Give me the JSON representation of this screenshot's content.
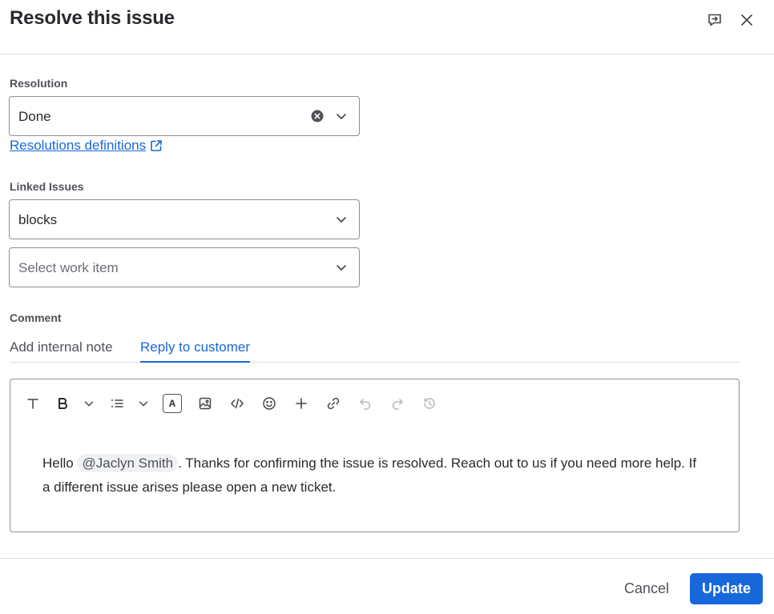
{
  "dialog": {
    "title": "Resolve this issue",
    "header_icons": [
      "feedback-icon",
      "close-icon"
    ]
  },
  "resolution": {
    "label": "Resolution",
    "value": "Done",
    "definitions_link": "Resolutions definitions"
  },
  "linked_issues": {
    "label": "Linked Issues",
    "link_type_value": "blocks",
    "work_item_placeholder": "Select work item"
  },
  "comment": {
    "label": "Comment",
    "tabs": [
      {
        "label": "Add internal note",
        "active": false
      },
      {
        "label": "Reply to customer",
        "active": true
      }
    ],
    "toolbar": [
      "text-style-icon",
      "bold-icon",
      "chevron-down-icon",
      "bullet-list-icon",
      "chevron-down-icon",
      "text-color-icon",
      "image-icon",
      "code-icon",
      "emoji-icon",
      "plus-icon",
      "link-icon",
      "undo-icon",
      "redo-icon",
      "history-icon"
    ],
    "text_color_glyph": "A",
    "body": {
      "prefix": "Hello",
      "mention": "@Jaclyn Smith",
      "suffix": ". Thanks for confirming the issue is resolved. Reach out to us if you need more help. If a different issue arises please open a new ticket."
    }
  },
  "footer": {
    "cancel_label": "Cancel",
    "update_label": "Update"
  },
  "colors": {
    "accent": "#1868db",
    "border": "#8c8f97",
    "divider": "#dcdfe4"
  }
}
